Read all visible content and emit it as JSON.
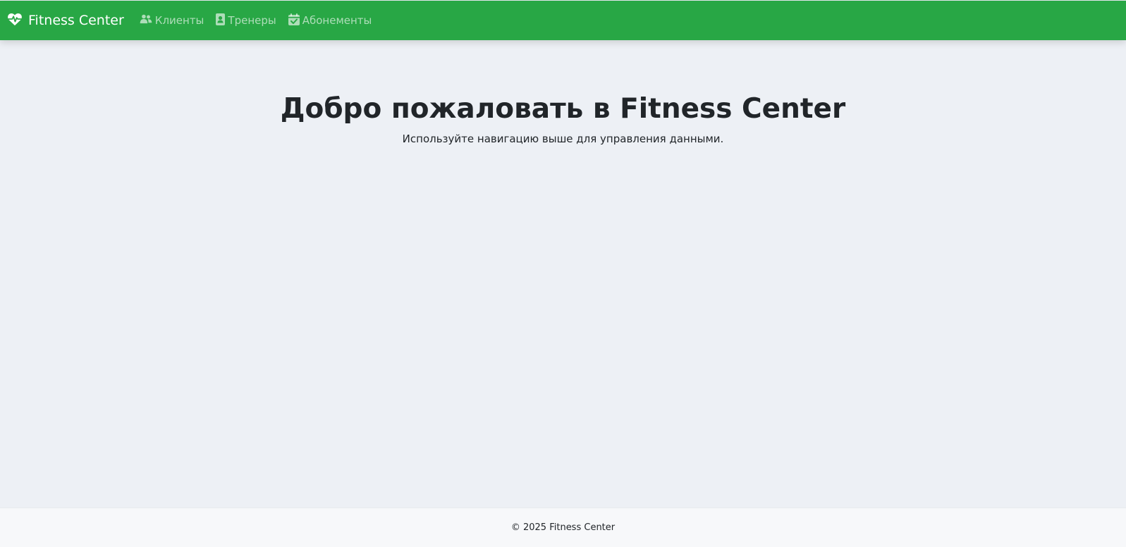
{
  "navbar": {
    "background_color": "#28a745",
    "brand": {
      "icon": "heart-pulse-icon",
      "label": "Fitness Center"
    },
    "links": [
      {
        "icon": "users-icon",
        "label": "Клиенты"
      },
      {
        "icon": "id-badge-icon",
        "label": "Тренеры"
      },
      {
        "icon": "calendar-check-icon",
        "label": "Абонементы"
      }
    ]
  },
  "main": {
    "heading": "Добро пожаловать в Fitness Center",
    "subtitle": "Используйте навигацию выше для управления данными."
  },
  "footer": {
    "text": "© 2025 Fitness Center"
  }
}
